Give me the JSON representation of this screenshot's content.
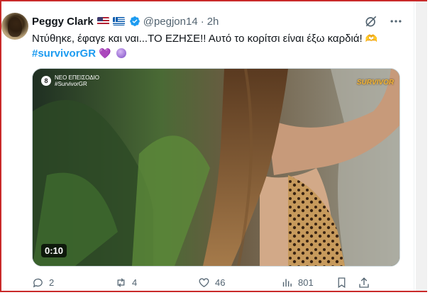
{
  "tweet": {
    "author_name": "Peggy Clark",
    "handle": "@pegjon14",
    "separator": "·",
    "time": "2h",
    "text_line1": "Ντύθηκε, έφαγε και ναι...ΤΟ ΕΖΗΣΕ!! Αυτό το κορίτσι είναι έξω καρδιά!",
    "hashtag": "#survivorGR",
    "flags": [
      "us-flag-icon",
      "greece-flag-icon"
    ],
    "verified": true
  },
  "media": {
    "episode_label": "ΝΕΟ ΕΠΕΙΣΟΔΙΟ",
    "episode_tag": "#SurvivorGR",
    "episode_number": "8",
    "brand": "SURVIVOR",
    "duration": "0:10"
  },
  "actions": {
    "replies": "2",
    "retweets": "4",
    "likes": "46",
    "views": "801"
  },
  "colors": {
    "text": "#0f1419",
    "secondary": "#536471",
    "accent": "#1d9bf0",
    "frame": "#c92a2a"
  }
}
